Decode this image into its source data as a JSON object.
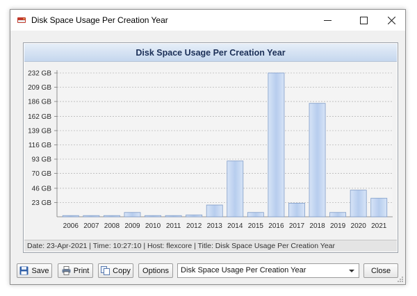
{
  "window": {
    "title": "Disk Space Usage Per Creation Year",
    "icon": "disk-drive-icon"
  },
  "chart": {
    "title": "Disk Space Usage Per Creation Year"
  },
  "chart_data": {
    "type": "bar",
    "title": "Disk Space Usage Per Creation Year",
    "xlabel": "",
    "ylabel": "",
    "categories": [
      "2006",
      "2007",
      "2008",
      "2009",
      "2010",
      "2011",
      "2012",
      "2013",
      "2014",
      "2015",
      "2016",
      "2017",
      "2018",
      "2019",
      "2020",
      "2021"
    ],
    "values": [
      2,
      2,
      2,
      7,
      2,
      2,
      3,
      19,
      90,
      7,
      232,
      22,
      183,
      7,
      43,
      30
    ],
    "unit": "GB",
    "yticks": [
      "23 GB",
      "46 GB",
      "70 GB",
      "93 GB",
      "116 GB",
      "139 GB",
      "162 GB",
      "186 GB",
      "209 GB",
      "232 GB"
    ],
    "ytick_values": [
      23,
      46,
      70,
      93,
      116,
      139,
      162,
      186,
      209,
      232
    ],
    "ylim": [
      0,
      232
    ],
    "grid": true,
    "bar_color": "#b7cdee",
    "bar_border": "#7f9cc8"
  },
  "status": {
    "text": "Date: 23-Apr-2021 | Time: 10:27:10 | Host: flexcore | Title: Disk Space Usage Per Creation Year"
  },
  "toolbar": {
    "save_label": "Save",
    "print_label": "Print",
    "copy_label": "Copy",
    "options_label": "Options",
    "close_label": "Close",
    "report_select_value": "Disk Space Usage Per Creation Year"
  }
}
